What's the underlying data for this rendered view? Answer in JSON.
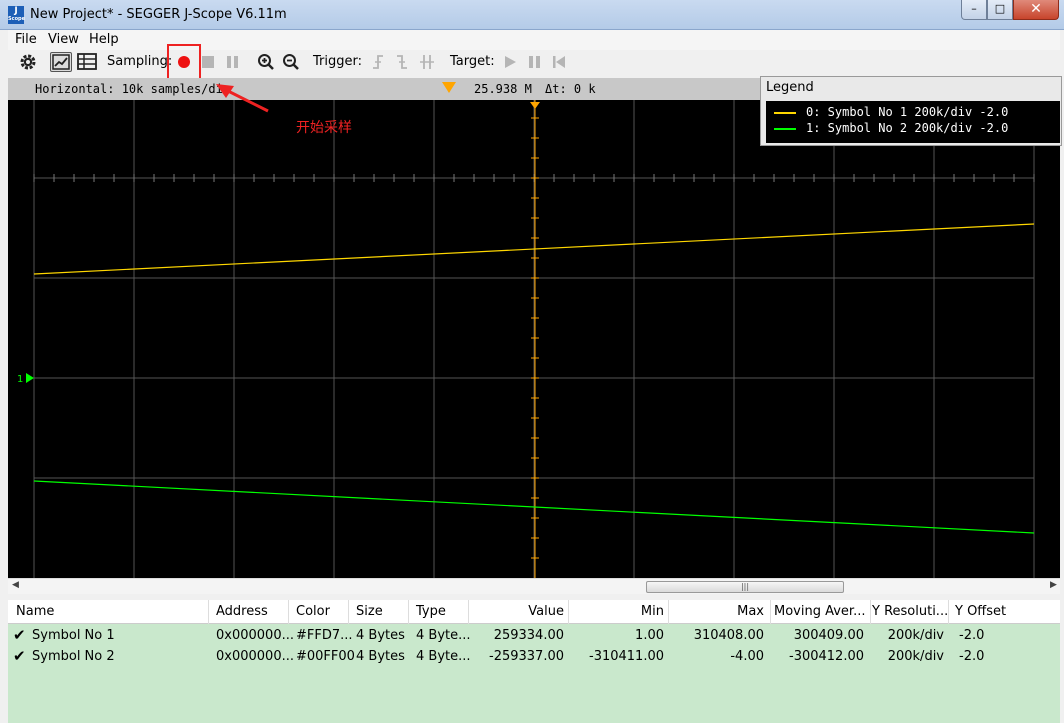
{
  "window": {
    "title": "New Project* - SEGGER J-Scope V6.11m",
    "icon_letter": "J",
    "icon_caption": "Scope"
  },
  "menu": [
    "File",
    "View",
    "Help"
  ],
  "toolbar": {
    "sampling_label": "Sampling:",
    "trigger_label": "Trigger:",
    "target_label": "Target:"
  },
  "scope_header": {
    "horizontal": "Horizontal: 10k samples/di",
    "cursor_value": "25.938 M",
    "delta_t": "Δt: 0 k"
  },
  "annotation": "开始采样",
  "channel_marker": "1",
  "legend": {
    "title": "Legend",
    "entries": [
      {
        "text": "0: Symbol No 1  200k/div -2.0",
        "color": "#FFD700"
      },
      {
        "text": "1: Symbol No 2  200k/div -2.0",
        "color": "#00FF00"
      }
    ]
  },
  "colors": {
    "series0": "#FFD700",
    "series1": "#00FF00",
    "cursor": "#FFA500",
    "grid": "#555555"
  },
  "table": {
    "headers": [
      "Name",
      "Address",
      "Color",
      "Size",
      "Type",
      "Value",
      "Min",
      "Max",
      "Moving Aver...",
      "Y Resoluti...",
      "Y Offset"
    ],
    "rows": [
      [
        "Symbol No 1",
        "0x000000...",
        "#FFD7...",
        "4 Bytes",
        "4 Byte...",
        "259334.00",
        "1.00",
        "310408.00",
        "300409.00",
        "200k/div",
        "-2.0"
      ],
      [
        "Symbol No 2",
        "0x000000...",
        "#00FF00",
        "4 Bytes",
        "4 Byte...",
        "-259337.00",
        "-310411.00",
        "-4.00",
        "-300412.00",
        "200k/div",
        "-2.0"
      ]
    ]
  }
}
